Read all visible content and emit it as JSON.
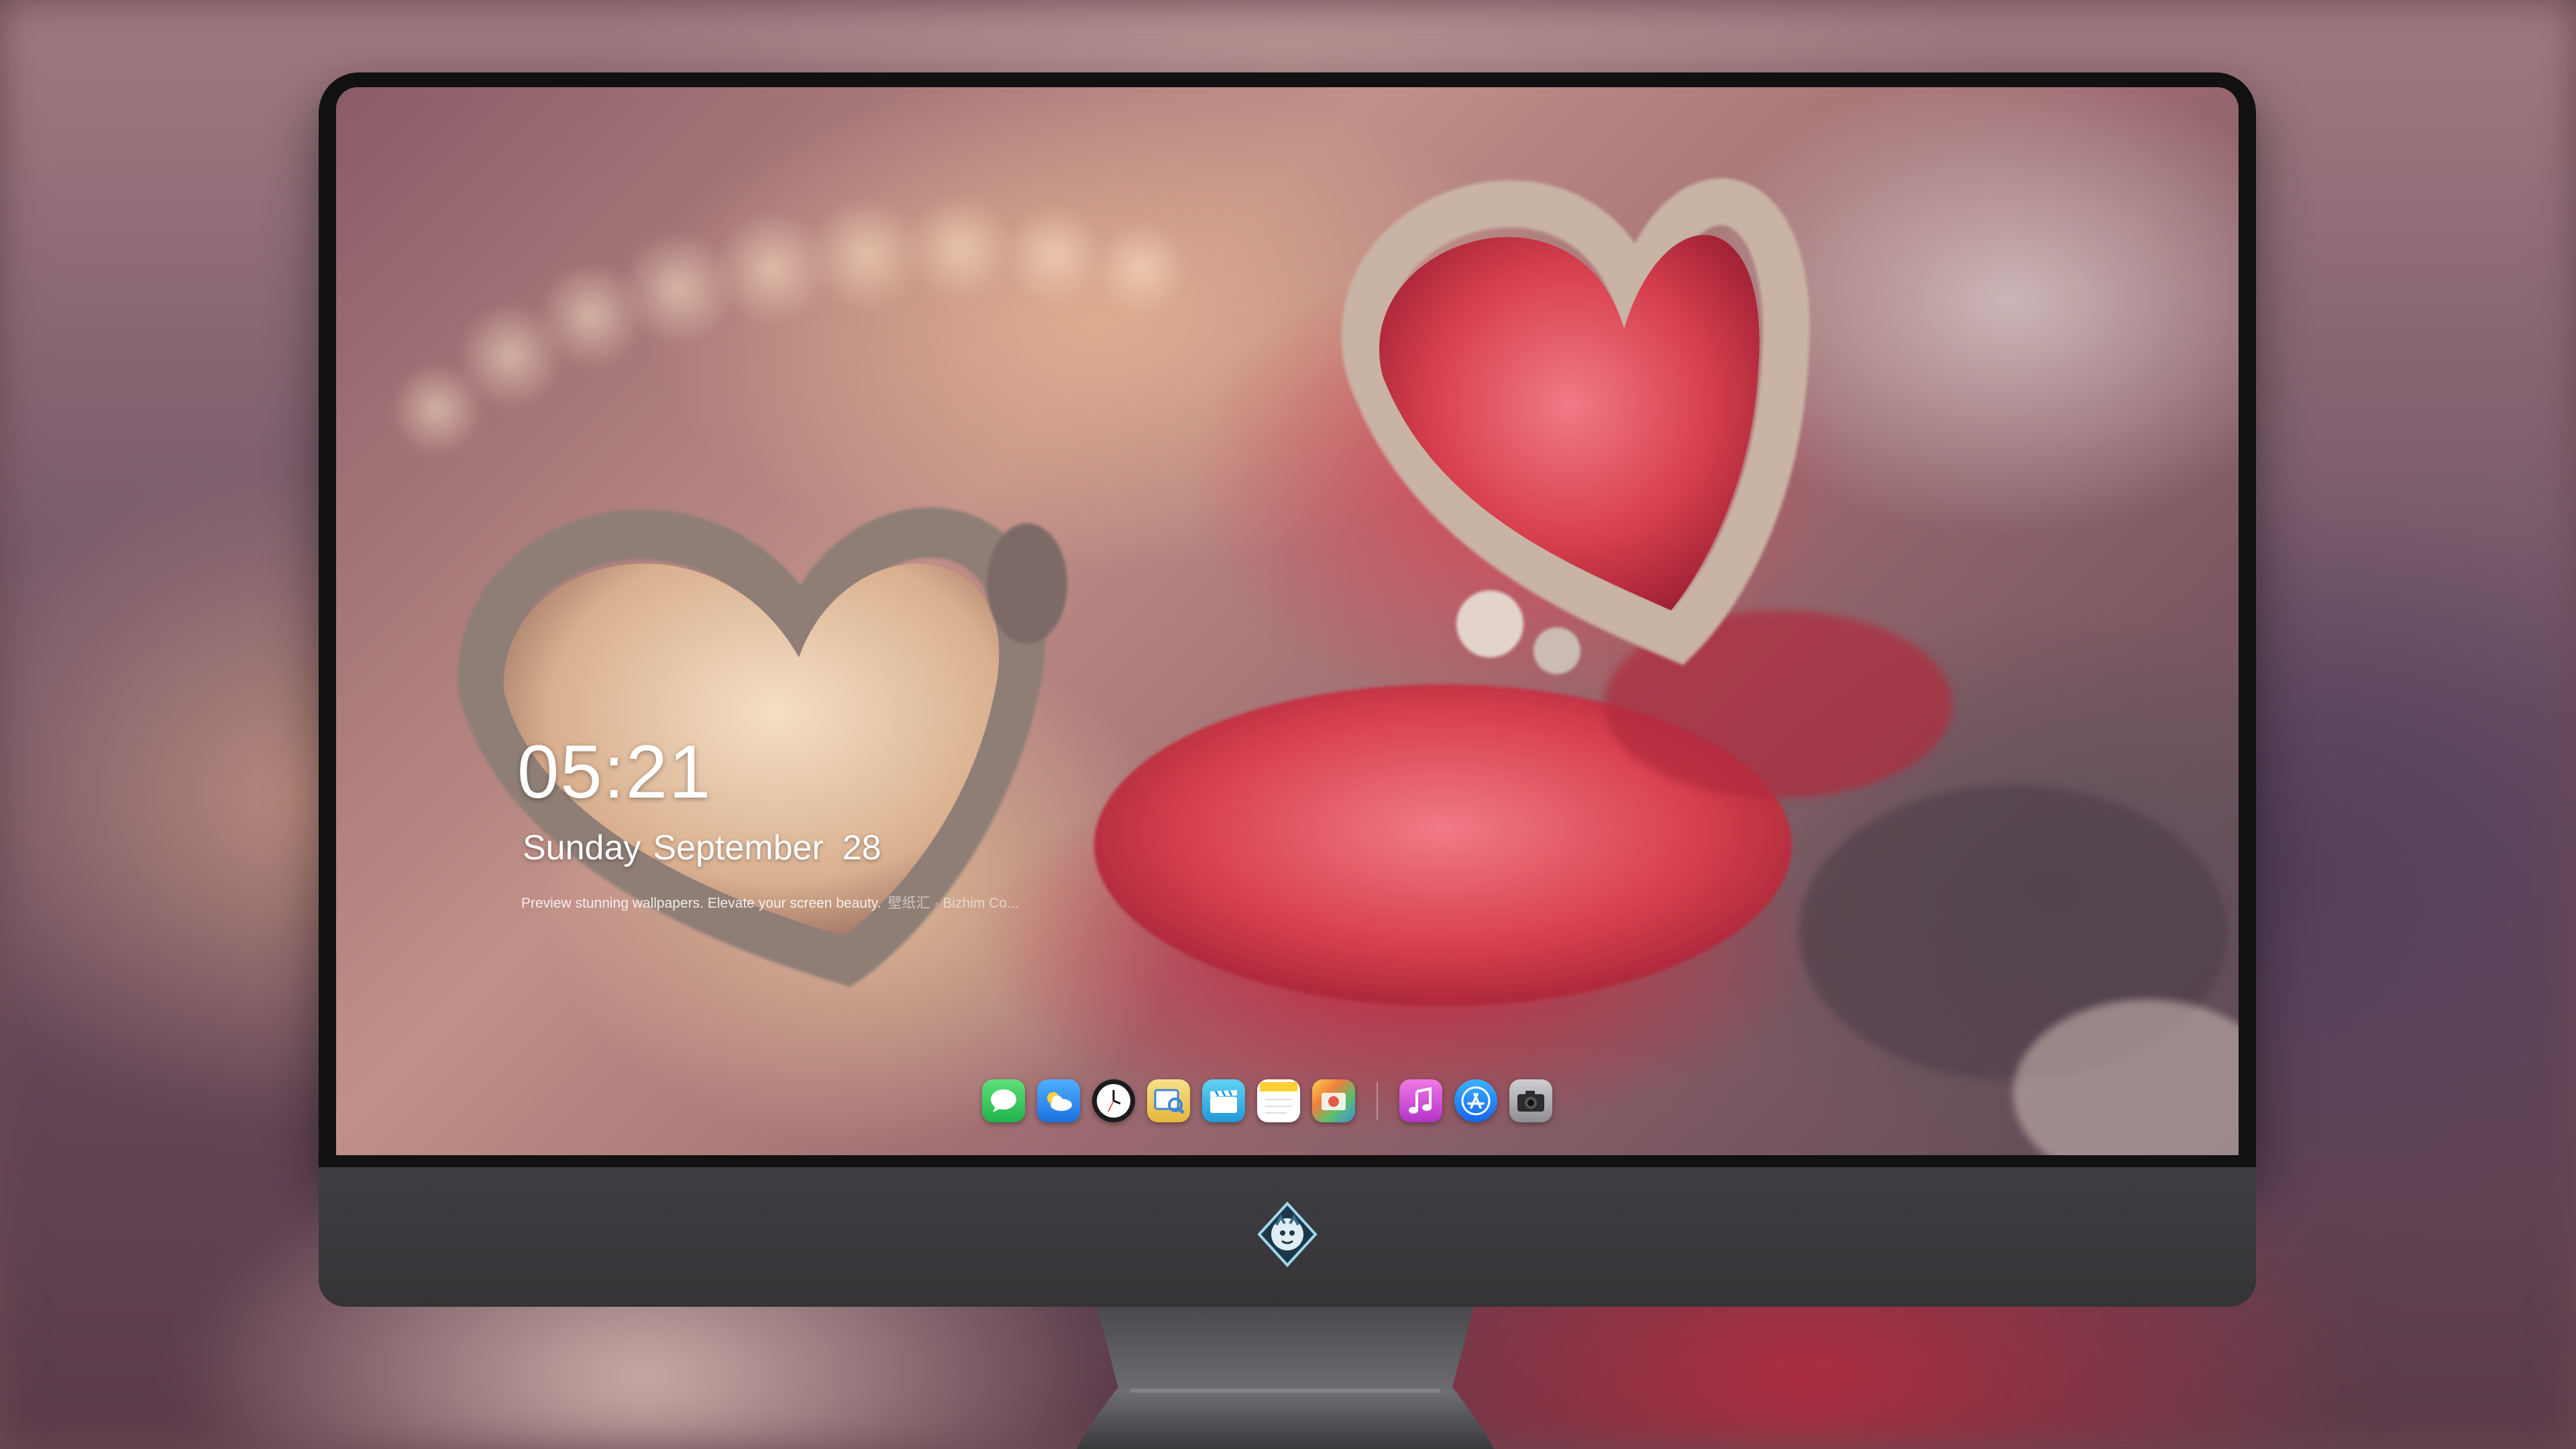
{
  "lockscreen": {
    "time": "05:21",
    "weekday": "Sunday",
    "month": "September",
    "day": "28",
    "tagline": "Preview stunning wallpapers. Elevate your screen beauty.",
    "brand": "壁纸汇 · Bizhim Co..."
  },
  "dock": {
    "items": [
      {
        "name": "messages-icon",
        "color": "#34c759"
      },
      {
        "name": "weather-icon",
        "color": "#2f8cf0"
      },
      {
        "name": "clock-icon",
        "color": "#ffffff"
      },
      {
        "name": "preview-icon",
        "color": "#f2c94c"
      },
      {
        "name": "clapper-icon",
        "color": "#3fb6e8"
      },
      {
        "name": "notes-icon",
        "color": "#ffd84a"
      },
      {
        "name": "photo-booth-icon",
        "color": "#e25b4a"
      },
      {
        "name": "music-icon",
        "color": "#d94fd6"
      },
      {
        "name": "app-store-icon",
        "color": "#1e8ef5"
      },
      {
        "name": "camera-icon",
        "color": "#5a5a5e"
      }
    ]
  },
  "monitor": {
    "chin_logo": "dragon-logo-icon"
  },
  "colors": {
    "bezel": "#111111",
    "chin": "#3f3e42",
    "accent_red": "#d83a50"
  }
}
